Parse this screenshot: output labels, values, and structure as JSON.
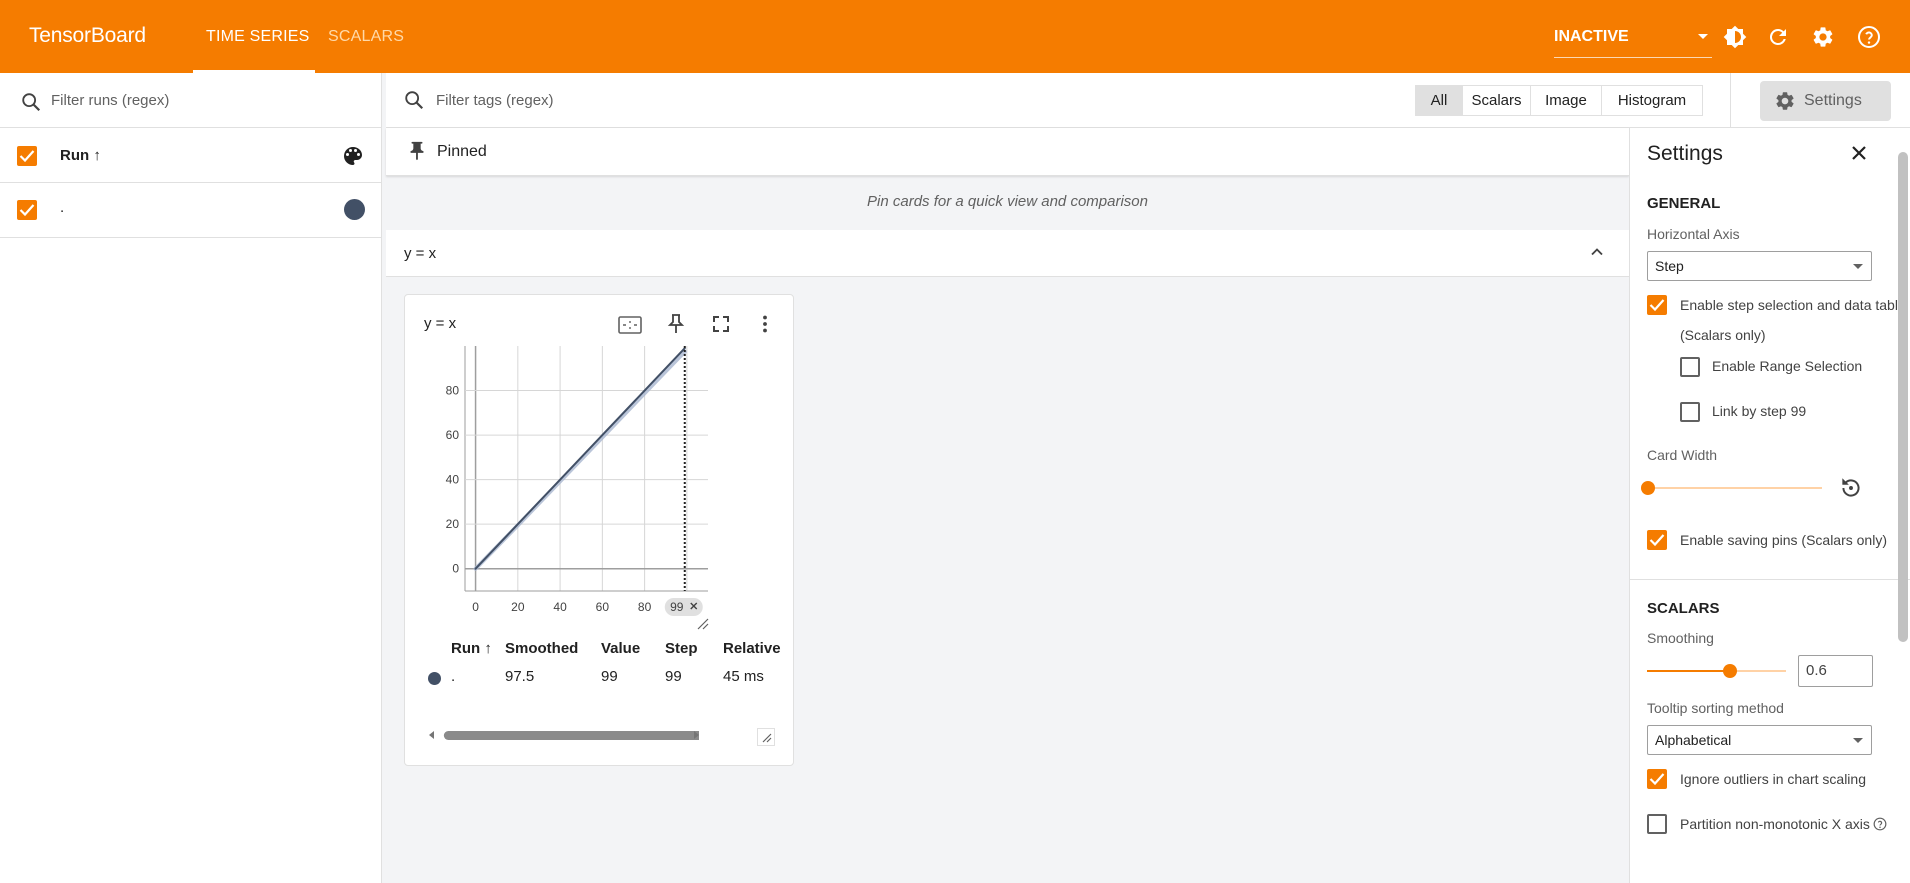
{
  "header": {
    "brand": "TensorBoard",
    "tabs": [
      {
        "label": "TIME SERIES",
        "active": true
      },
      {
        "label": "SCALARS",
        "active": false
      }
    ],
    "status": "INACTIVE"
  },
  "runs": {
    "filter_placeholder": "Filter runs (regex)",
    "column_label": "Run ↑",
    "items": [
      {
        "name": ".",
        "color": "#425066",
        "checked": true
      }
    ]
  },
  "tags": {
    "filter_placeholder": "Filter tags (regex)",
    "types": [
      "All",
      "Scalars",
      "Image",
      "Histogram"
    ],
    "active_type": "All",
    "settings_label": "Settings"
  },
  "pinned": {
    "title": "Pinned",
    "hint": "Pin cards for a quick view and comparison"
  },
  "group": {
    "title": "y = x"
  },
  "card": {
    "title": "y = x",
    "step_marker": "99",
    "table": {
      "headers": [
        "Run ↑",
        "Smoothed",
        "Value",
        "Step",
        "Relative"
      ],
      "rows": [
        {
          "run": ".",
          "smoothed": "97.5",
          "value": "99",
          "step": "99",
          "relative": "45 ms"
        }
      ]
    }
  },
  "chart_data": {
    "type": "line",
    "title": "y = x",
    "x_ticks": [
      "0",
      "20",
      "40",
      "60",
      "80"
    ],
    "y_ticks": [
      "0",
      "20",
      "40",
      "60",
      "80"
    ],
    "xlim": [
      -5,
      110
    ],
    "ylim": [
      -10,
      100
    ],
    "grid": true,
    "series": [
      {
        "name": ".",
        "color": "#425066",
        "x": [
          0,
          20,
          40,
          60,
          80,
          99
        ],
        "y": [
          0,
          20,
          40,
          60,
          80,
          99
        ]
      },
      {
        "color": "#a9b7d0",
        "x": [
          0,
          20,
          40,
          60,
          80,
          99
        ],
        "y": [
          0,
          19.5,
          39.2,
          59,
          78.8,
          97.5
        ]
      }
    ],
    "step_selection": 99
  },
  "settings": {
    "title": "Settings",
    "general_heading": "GENERAL",
    "horizontal_axis_label": "Horizontal Axis",
    "horizontal_axis_value": "Step",
    "enable_step_selection": "Enable step selection and data table",
    "scalars_only": "(Scalars only)",
    "enable_range_selection": "Enable Range Selection",
    "link_by_step": "Link by step 99",
    "card_width_label": "Card Width",
    "card_width_level": 0,
    "enable_saving_pins": "Enable saving pins (Scalars only)",
    "scalars_heading": "SCALARS",
    "smoothing_label": "Smoothing",
    "smoothing_value": "0.6",
    "tooltip_sort_label": "Tooltip sorting method",
    "tooltip_sort_value": "Alphabetical",
    "ignore_outliers": "Ignore outliers in chart scaling",
    "partition_non_monotonic": "Partition non-monotonic X axis"
  },
  "colors": {
    "accent": "#f57c00",
    "run_color": "#425066"
  }
}
